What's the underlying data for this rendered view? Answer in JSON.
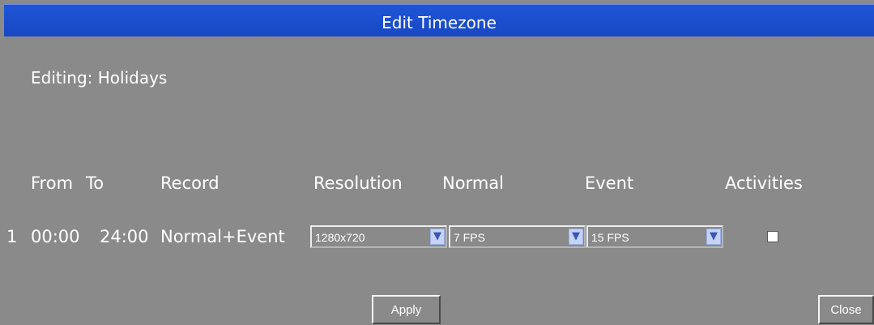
{
  "dialog": {
    "title": "Edit Timezone",
    "editing_label": "Editing: Holidays"
  },
  "headers": {
    "from": "From",
    "to": "To",
    "record": "Record",
    "resolution": "Resolution",
    "normal": "Normal",
    "event": "Event",
    "activities": "Activities"
  },
  "rows": [
    {
      "index": "1",
      "from": "00:00",
      "to": "24:00",
      "record": "Normal+Event",
      "resolution": "1280x720",
      "normal_fps": "7 FPS",
      "event_fps": "15 FPS",
      "activities_checked": false
    }
  ],
  "buttons": {
    "apply": "Apply",
    "close": "Close"
  },
  "colors": {
    "titlebar": "#1f55d6",
    "background": "#8a8a8a",
    "dropdown_arrow": "#c6d3f5"
  }
}
